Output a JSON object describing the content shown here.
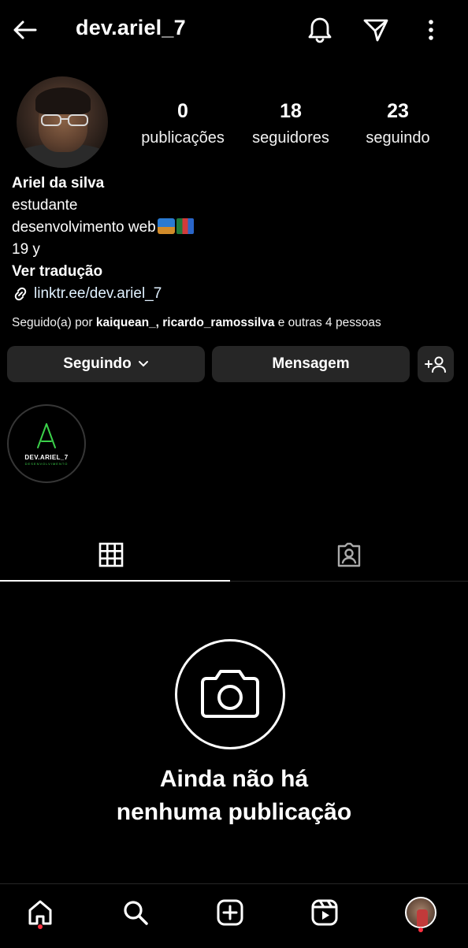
{
  "header": {
    "username": "dev.ariel_7",
    "icons": [
      "arrow-left-icon",
      "bell-icon",
      "send-icon",
      "more-vertical-icon"
    ]
  },
  "profile": {
    "stats": [
      {
        "value": "0",
        "label": "publicações"
      },
      {
        "value": "18",
        "label": "seguidores"
      },
      {
        "value": "23",
        "label": "seguindo"
      }
    ],
    "bio": {
      "name": "Ariel da silva",
      "line1": "estudante",
      "line2": "desenvolvimento web",
      "line3": "19 y",
      "translate": "Ver tradução",
      "link": "linktr.ee/dev.ariel_7"
    },
    "followed_by": {
      "prefix": "Seguido(a) por ",
      "users": "kaiquean_, ricardo_ramossilva",
      "suffix": " e outras 4 pessoas"
    }
  },
  "actions": {
    "following_label": "Seguindo",
    "message_label": "Mensagem"
  },
  "highlight": {
    "title": "DEV.ARIEL_7",
    "subtitle": "DESENVOLVIMENTO"
  },
  "empty_state": {
    "line1": "Ainda não há",
    "line2": "nenhuma publicação"
  },
  "bottom_nav": {
    "items": [
      "home-icon",
      "search-icon",
      "create-icon",
      "reels-icon",
      "profile-avatar"
    ]
  },
  "colors": {
    "background": "#000000",
    "button": "#262626",
    "notification_dot": "#ff3040",
    "link": "#e0f1ff",
    "highlight_green": "#3bd14a"
  }
}
